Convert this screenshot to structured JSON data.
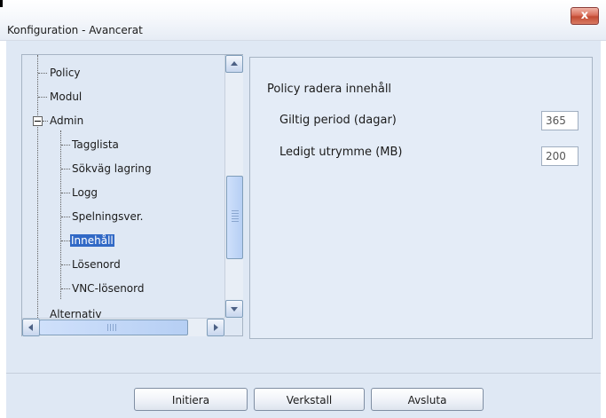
{
  "window": {
    "title": "Konfiguration - Avancerat",
    "close_glyph": "x",
    "close_icon": "close-icon"
  },
  "tree": {
    "items": [
      {
        "label": "Policy",
        "level": 0
      },
      {
        "label": "Modul",
        "level": 0
      },
      {
        "label": "Admin",
        "level": 0,
        "expander": "⊟"
      },
      {
        "label": "Tagglista",
        "level": 1
      },
      {
        "label": "Sökväg lagring",
        "level": 1
      },
      {
        "label": "Logg",
        "level": 1
      },
      {
        "label": "Spelningsver.",
        "level": 1
      },
      {
        "label": "Innehåll",
        "level": 1,
        "selected": true
      },
      {
        "label": "Lösenord",
        "level": 1
      },
      {
        "label": "VNC-lösenord",
        "level": 1
      },
      {
        "label": "Alternativ",
        "level": 0,
        "partial": true
      }
    ]
  },
  "settings": {
    "section_title": "Policy radera innehåll",
    "fields": [
      {
        "label": "Giltig period (dagar)",
        "value": "365"
      },
      {
        "label": "Ledigt utrymme (MB)",
        "value": "200"
      }
    ]
  },
  "footer": {
    "buttons": {
      "initiera": "Initiera",
      "verkstall": "Verkstall",
      "avsluta": "Avsluta"
    }
  },
  "colors": {
    "selection": "#3169c6",
    "panel_background": "#dfe8f4",
    "close_button": "#c34b33"
  }
}
